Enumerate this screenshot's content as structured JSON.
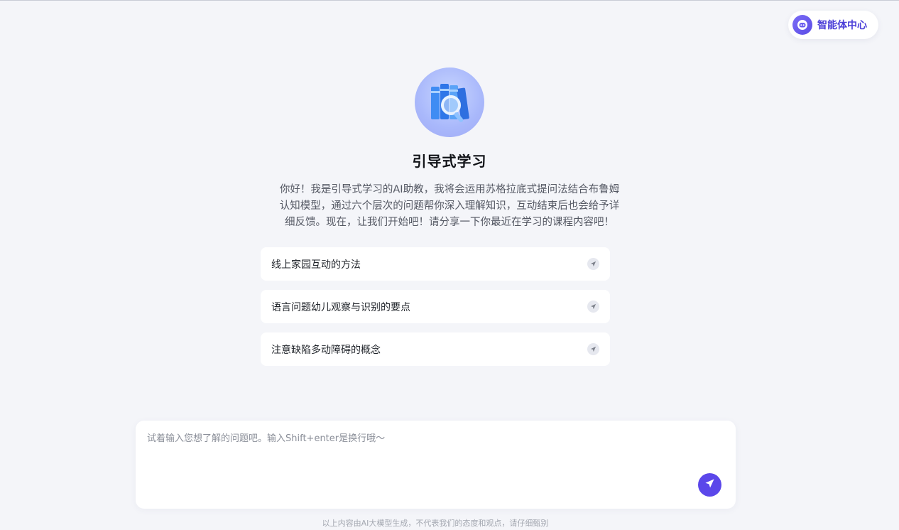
{
  "header": {
    "agent_center_label": "智能体中心",
    "agent_center_icon": "robot-face-icon"
  },
  "hero": {
    "avatar_icon": "books-magnifier-icon",
    "title": "引导式学习",
    "intro": "你好！我是引导式学习的AI助教，我将会运用苏格拉底式提问法结合布鲁姆认知模型，通过六个层次的问题帮你深入理解知识，互动结束后也会给予详细反馈。现在，让我们开始吧！请分享一下你最近在学习的课程内容吧！"
  },
  "suggestions": [
    {
      "text": "线上家园互动的方法",
      "icon": "send-icon"
    },
    {
      "text": "语言问题幼儿观察与识别的要点",
      "icon": "send-icon"
    },
    {
      "text": "注意缺陷多动障碍的概念",
      "icon": "send-icon"
    }
  ],
  "composer": {
    "placeholder": "试着输入您想了解的问题吧。输入Shift+enter是换行哦～",
    "value": "",
    "send_icon": "send-icon"
  },
  "footer": {
    "disclaimer": "以上内容由AI大模型生成，不代表我们的态度和观点，请仔细甄别"
  },
  "colors": {
    "accent": "#5b47ea",
    "background": "#f4f5f9",
    "card": "#ffffff"
  }
}
